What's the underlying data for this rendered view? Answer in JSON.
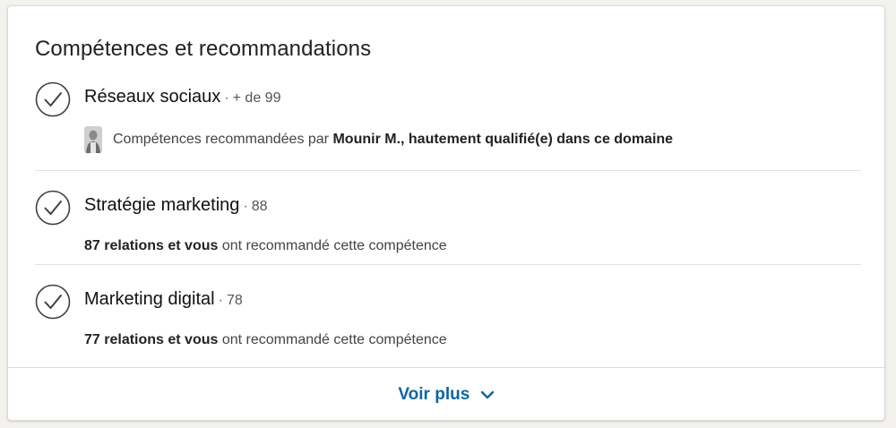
{
  "section": {
    "title": "Compétences et recommandations"
  },
  "skills": [
    {
      "name": "Réseaux sociaux",
      "separator": "·",
      "count": "+ de 99",
      "endorsement": {
        "prefix": "Compétences recommandées par",
        "highlight": "Mounir M., hautement qualifié(e) dans ce domaine"
      }
    },
    {
      "name": "Stratégie marketing",
      "separator": "·",
      "count": "88",
      "endorsement": {
        "highlight": "87 relations et vous",
        "suffix": "ont recommandé cette compétence"
      }
    },
    {
      "name": "Marketing digital",
      "separator": "·",
      "count": "78",
      "endorsement": {
        "highlight": "77 relations et vous",
        "suffix": "ont recommandé cette compétence"
      }
    }
  ],
  "footer": {
    "more_label": "Voir plus"
  },
  "colors": {
    "link": "#0a66a0",
    "icon_stroke": "#404040"
  },
  "icons": {
    "check": "check-circle-icon",
    "chevron": "chevron-down-icon"
  }
}
